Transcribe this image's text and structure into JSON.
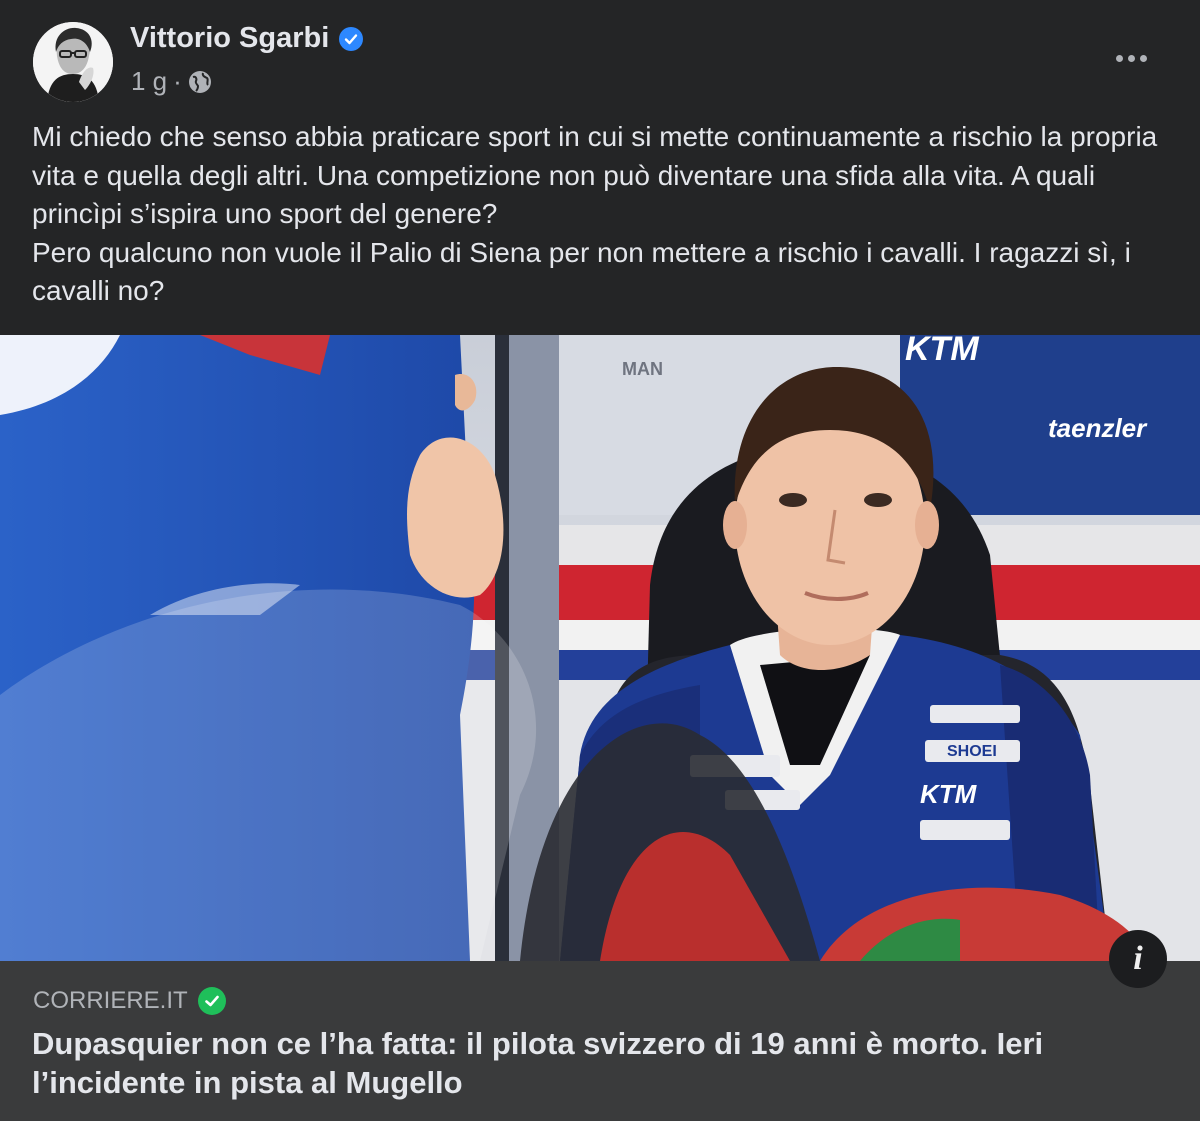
{
  "post": {
    "author": "Vittorio Sgarbi",
    "time": "1 g",
    "separator": "·",
    "icons": {
      "verified": "verified-badge-icon",
      "audience": "globe-icon",
      "more": "more-options-icon"
    },
    "text_paragraphs": [
      "Mi chiedo che senso abbia praticare sport in cui si mette  continuamente a rischio la propria vita e quella degli altri.  Una competizione non può diventare una sfida alla vita.  A quali princìpi s’ispira uno sport del genere?",
      "Pero qualcuno non vuole il Palio di Siena per non mettere a rischio i cavalli. I ragazzi sì, i cavalli no?"
    ]
  },
  "media": {
    "sponsor_logos": [
      "MAN",
      "KTM",
      "taenzler",
      "SHOEI",
      "KTM"
    ],
    "info_label": "i"
  },
  "link_preview": {
    "domain": "CORRIERE.IT",
    "headline": "Dupasquier non ce l’ha fatta: il pilota svizzero di 19 anni è morto. Ieri l’incidente in pista al Mugello"
  },
  "colors": {
    "background": "#242526",
    "link_background": "#3a3b3c",
    "text_primary": "#e4e6eb",
    "text_secondary": "#b0b3b8",
    "verified_blue": "#2d88ff",
    "domain_check_green": "#1fbf5a"
  }
}
